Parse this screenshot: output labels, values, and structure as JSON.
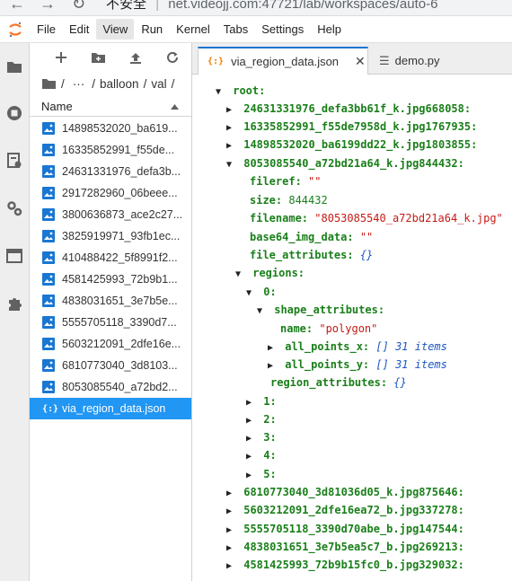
{
  "browser": {
    "url_prefix": "不安全",
    "url": "net.videojj.com:47721/lab/workspaces/auto-6"
  },
  "menu": {
    "items": [
      "File",
      "Edit",
      "View",
      "Run",
      "Kernel",
      "Tabs",
      "Settings",
      "Help"
    ],
    "active": "View"
  },
  "filebrowser": {
    "breadcrumb": [
      "/",
      "···",
      "/",
      "balloon",
      "/",
      "val",
      "/"
    ],
    "column_name": "Name",
    "files": [
      {
        "name": "14898532020_ba619...",
        "type": "image"
      },
      {
        "name": "16335852991_f55de...",
        "type": "image"
      },
      {
        "name": "24631331976_defa3b...",
        "type": "image"
      },
      {
        "name": "2917282960_06beee...",
        "type": "image"
      },
      {
        "name": "3800636873_ace2c27...",
        "type": "image"
      },
      {
        "name": "3825919971_93fb1ec...",
        "type": "image"
      },
      {
        "name": "410488422_5f8991f2...",
        "type": "image"
      },
      {
        "name": "4581425993_72b9b1...",
        "type": "image"
      },
      {
        "name": "4838031651_3e7b5e...",
        "type": "image"
      },
      {
        "name": "5555705118_3390d7...",
        "type": "image"
      },
      {
        "name": "5603212091_2dfe16e...",
        "type": "image"
      },
      {
        "name": "6810773040_3d8103...",
        "type": "image"
      },
      {
        "name": "8053085540_a72bd2...",
        "type": "image"
      },
      {
        "name": "via_region_data.json",
        "type": "json",
        "selected": true
      }
    ],
    "json_icon_glyph": "{:}"
  },
  "tabs": [
    {
      "label": "via_region_data.json",
      "active": true,
      "icon": "{:}",
      "close": "✕"
    },
    {
      "label": "demo.py",
      "active": false,
      "icon": "☰"
    }
  ],
  "tree": {
    "root": "root:",
    "top_entries": [
      "24631331976_defa3bb61f_k.jpg668058:",
      "16335852991_f55de7958d_k.jpg1767935:",
      "14898532020_ba6199dd22_k.jpg1803855:"
    ],
    "expanded_entry": "8053085540_a72bd21a64_k.jpg844432:",
    "fields": {
      "fileref_key": "fileref:",
      "fileref_val": "\"\"",
      "size_key": "size:",
      "size_val": "844432",
      "filename_key": "filename:",
      "filename_val": "\"8053085540_a72bd21a64_k.jpg\"",
      "base64_key": "base64_img_data:",
      "base64_val": "\"\"",
      "file_attr_key": "file_attributes:",
      "file_attr_val": "{}"
    },
    "regions_key": "regions:",
    "region0_key": "0:",
    "shape_attr_key": "shape_attributes:",
    "name_key": "name:",
    "name_val": "\"polygon\"",
    "all_x_key": "all_points_x:",
    "all_y_key": "all_points_y:",
    "array_meta": "[] 31 items",
    "region_attr_key": "region_attributes:",
    "region_attr_val": "{}",
    "collapsed_regions": [
      "1:",
      "2:",
      "3:",
      "4:",
      "5:"
    ],
    "bottom_entries": [
      "6810773040_3d81036d05_k.jpg875646:",
      "5603212091_2dfe16ea72_b.jpg337278:",
      "5555705118_3390d70abe_b.jpg147544:",
      "4838031651_3e7b5ea5c7_b.jpg269213:",
      "4581425993_72b9b15fc0_b.jpg329032:"
    ]
  },
  "colors": {
    "accent": "#2196f3",
    "key": "#1a7f1a",
    "string": "#c41a16",
    "meta": "#1a55c4"
  }
}
